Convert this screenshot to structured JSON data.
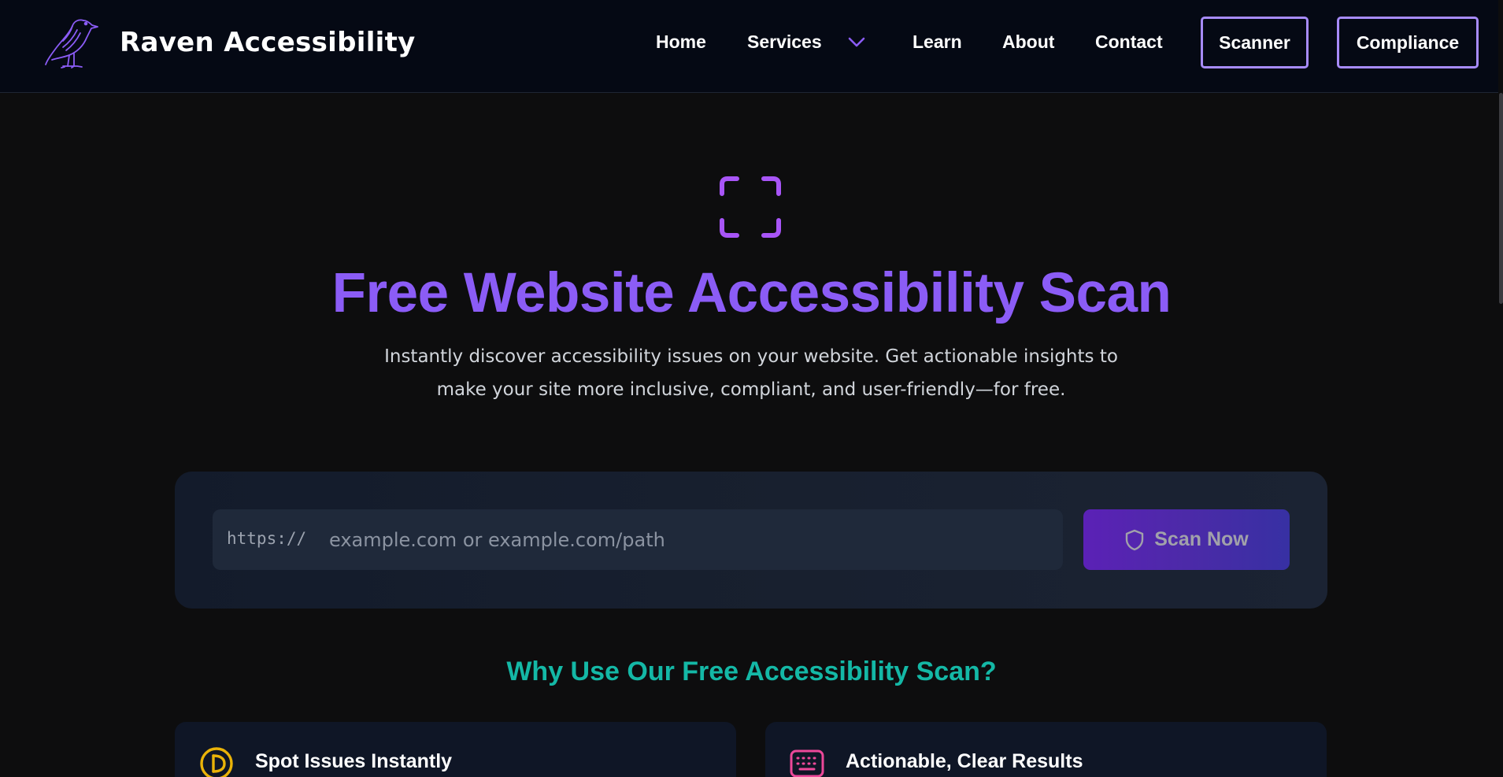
{
  "brand": {
    "name": "Raven Accessibility",
    "logo_icon": "raven-icon"
  },
  "nav": {
    "home": "Home",
    "services": "Services",
    "services_icon": "chevron-down-icon",
    "learn": "Learn",
    "about": "About",
    "contact": "Contact",
    "scanner": "Scanner",
    "compliance": "Compliance"
  },
  "hero": {
    "icon": "scan-frame-icon",
    "title": "Free Website Accessibility Scan",
    "subtitle": "Instantly discover accessibility issues on your website. Get actionable insights to make your site more inclusive, compliant, and user-friendly—for free."
  },
  "scan": {
    "prefix": "https://",
    "placeholder": "example.com or example.com/path",
    "value": "",
    "button_label": "Scan Now",
    "button_icon": "shield-icon"
  },
  "why": {
    "title": "Why Use Our Free Accessibility Scan?",
    "cards": [
      {
        "icon": "clock-icon",
        "title": "Spot Issues Instantly"
      },
      {
        "icon": "keyboard-icon",
        "title": "Actionable, Clear Results"
      }
    ]
  },
  "colors": {
    "accent_purple": "#8b5cf6",
    "accent_teal": "#14b8a6",
    "nav_button_border": "#a78bfa",
    "icon_yellow": "#eab308",
    "icon_pink": "#ec4899",
    "header_bg": "#050914",
    "page_bg": "#0d0d0e"
  }
}
